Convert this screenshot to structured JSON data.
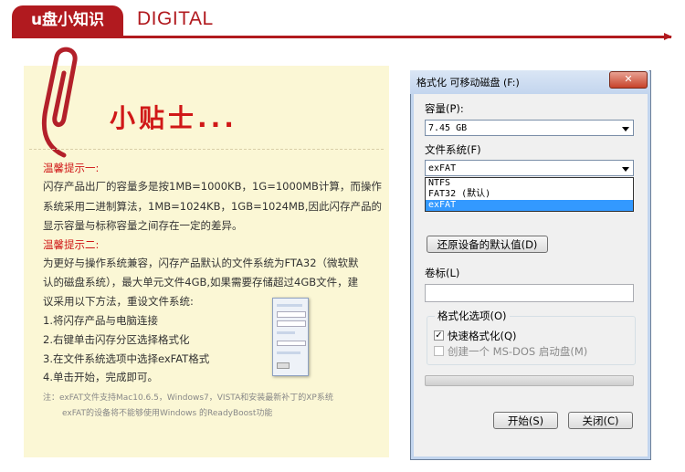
{
  "header": {
    "tab_label": "u盘小知识",
    "subtitle": "DIGITAL"
  },
  "note": {
    "title": "小贴士...",
    "tip1_heading": "温馨提示一:",
    "tip1_lines": [
      "闪存产品出厂的容量多是按1MB=1000KB，1G=1000MB计算，而操作",
      "系统采用二进制算法，1MB=1024KB，1GB=1024MB,因此闪存产品的",
      "显示容量与标称容量之间存在一定的差异。"
    ],
    "tip2_heading": "温馨提示二:",
    "tip2_lines": [
      "为更好与操作系统兼容，闪存产品默认的文件系统为FTA32（微软默",
      "认的磁盘系统），最大单元文件4GB,如果需要存储超过4GB文件，建",
      "议采用以下方法，重设文件系统:"
    ],
    "steps": [
      "1.将闪存产品与电脑连接",
      "2.右键单击闪存分区选择格式化",
      "3.在文件系统选项中选择exFAT格式",
      "4.单击开始，完成即可。"
    ],
    "footnote_lines": [
      "注：exFAT文件支持Mac10.6.5，Windows7，VISTA和安装最新补丁的XP系统",
      "exFAT的设备将不能够使用Windows 的ReadyBoost功能"
    ]
  },
  "dialog": {
    "title": "格式化 可移动磁盘 (F:)",
    "close_glyph": "✕",
    "capacity_label": "容量(P):",
    "capacity_value": "7.45 GB",
    "filesystem_label": "文件系统(F)",
    "filesystem_value": "exFAT",
    "filesystem_options": [
      "NTFS",
      "FAT32 (默认)",
      "exFAT"
    ],
    "restore_defaults_button": "还原设备的默认值(D)",
    "volume_label": "卷标(L)",
    "volume_value": "",
    "format_options_label": "格式化选项(O)",
    "quick_format_label": "快速格式化(Q)",
    "quick_format_checked": true,
    "msdos_label": "创建一个 MS-DOS 启动盘(M)",
    "msdos_checked": false,
    "start_button": "开始(S)",
    "close_button": "关闭(C)",
    "check_glyph": "✓"
  }
}
